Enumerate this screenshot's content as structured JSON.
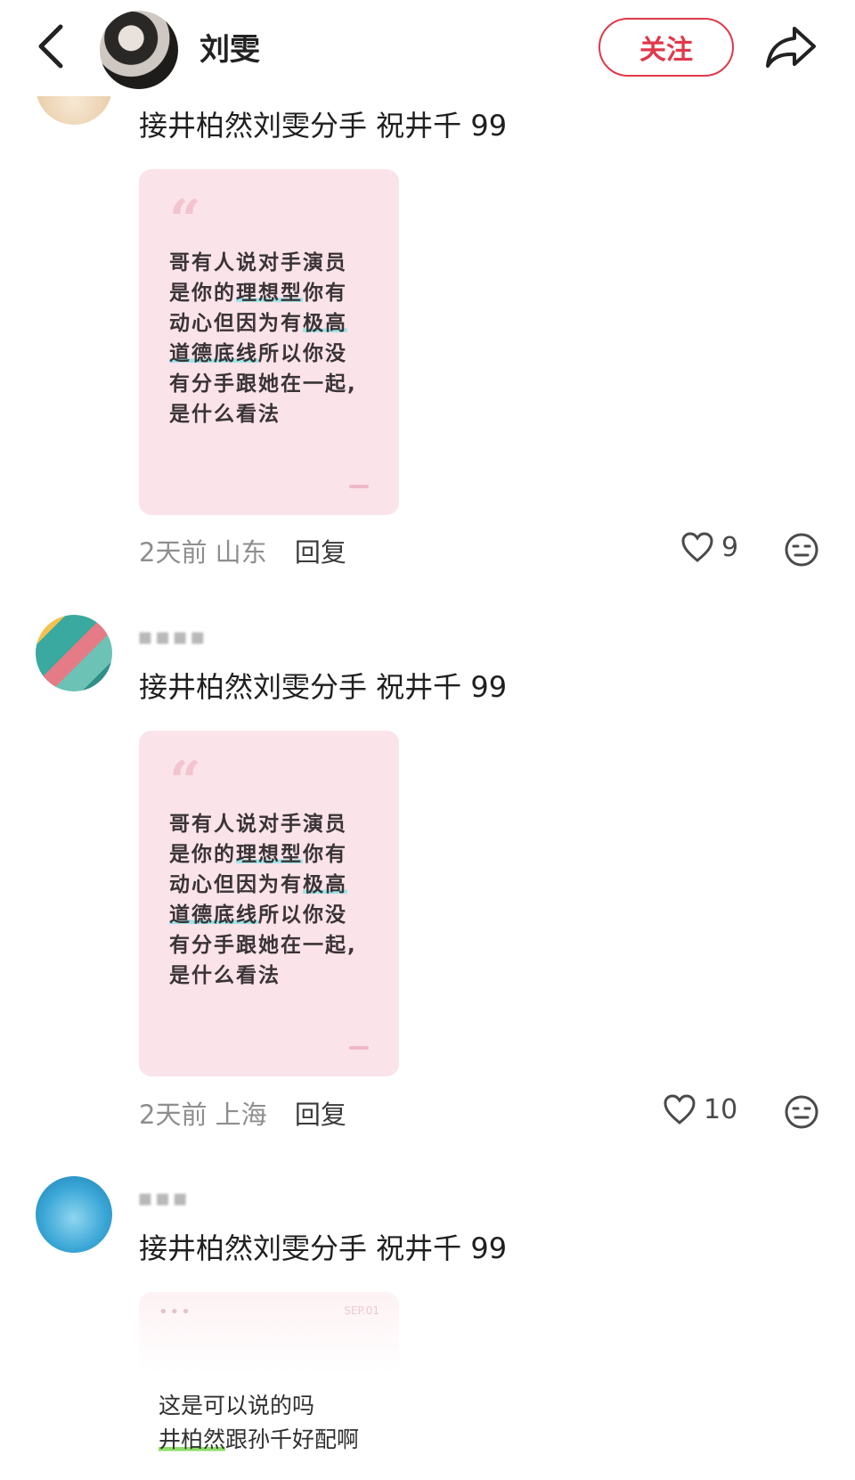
{
  "header": {
    "author_name": "刘雯",
    "follow_label": "关注"
  },
  "comments": [
    {
      "text": "接井柏然刘雯分手 祝井千 99",
      "card": {
        "lines": [
          "哥有人说对手演员",
          "是你的理想型你有",
          "动心但因为有极高",
          "道德底线所以你没",
          "有分手跟她在一起,",
          "是什么看法"
        ]
      },
      "time": "2天前",
      "location": "山东",
      "reply_label": "回复",
      "likes": "9"
    },
    {
      "name": "▪▪▪▪",
      "text": "接井柏然刘雯分手 祝井千 99",
      "card": {
        "lines": [
          "哥有人说对手演员",
          "是你的理想型你有",
          "动心但因为有极高",
          "道德底线所以你没",
          "有分手跟她在一起,",
          "是什么看法"
        ]
      },
      "time": "2天前",
      "location": "上海",
      "reply_label": "回复",
      "likes": "10"
    },
    {
      "name": "▪▪▪",
      "text": "接井柏然刘雯分手 祝井千 99",
      "card": {
        "dots": "•••",
        "date": "SEP.01",
        "line1": "这是可以说的吗",
        "line2_highlight": "井柏然",
        "line2_rest": "跟孙千好配啊"
      }
    }
  ]
}
